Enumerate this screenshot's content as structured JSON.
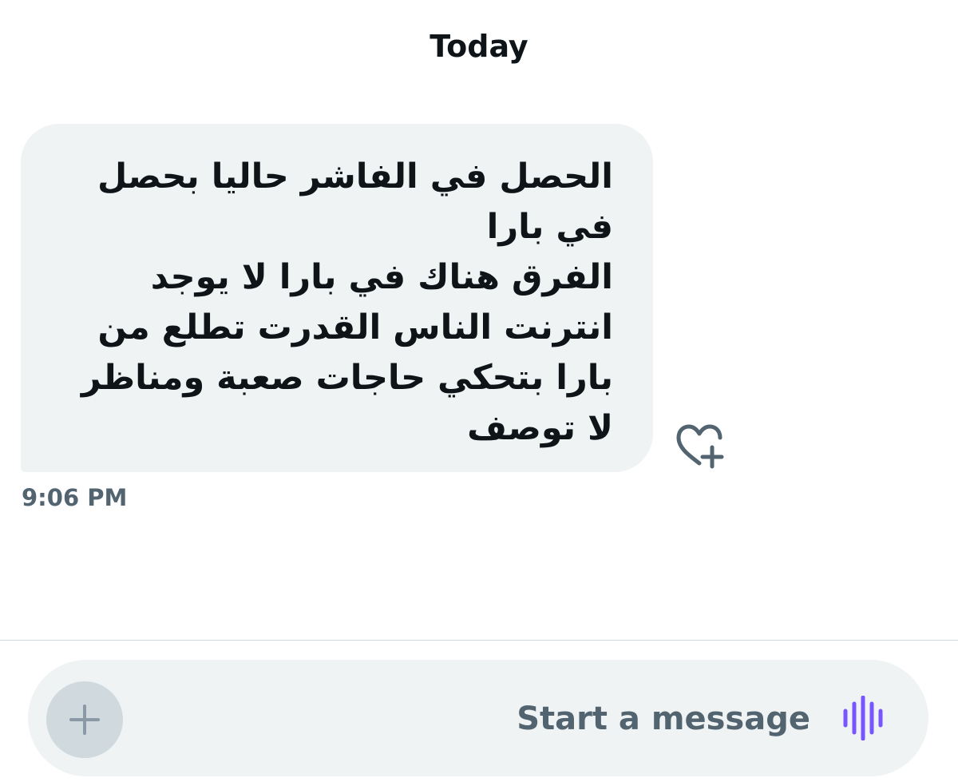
{
  "conversation": {
    "day_label": "Today"
  },
  "message": {
    "text": "الحصل في الفاشر حاليا بحصل\nفي بارا\nالفرق هناك في بارا لا يوجد\nانترنت الناس القدرت تطلع من\nبارا بتحكي حاجات صعبة ومناظر\nلا توصف",
    "timestamp": "9:06 PM",
    "react_icon": "heart-plus-icon"
  },
  "composer": {
    "placeholder": "Start a message",
    "value": "",
    "add_icon": "plus-icon",
    "voice_icon": "voice-waveform-icon",
    "voice_color": "#7856ff"
  }
}
